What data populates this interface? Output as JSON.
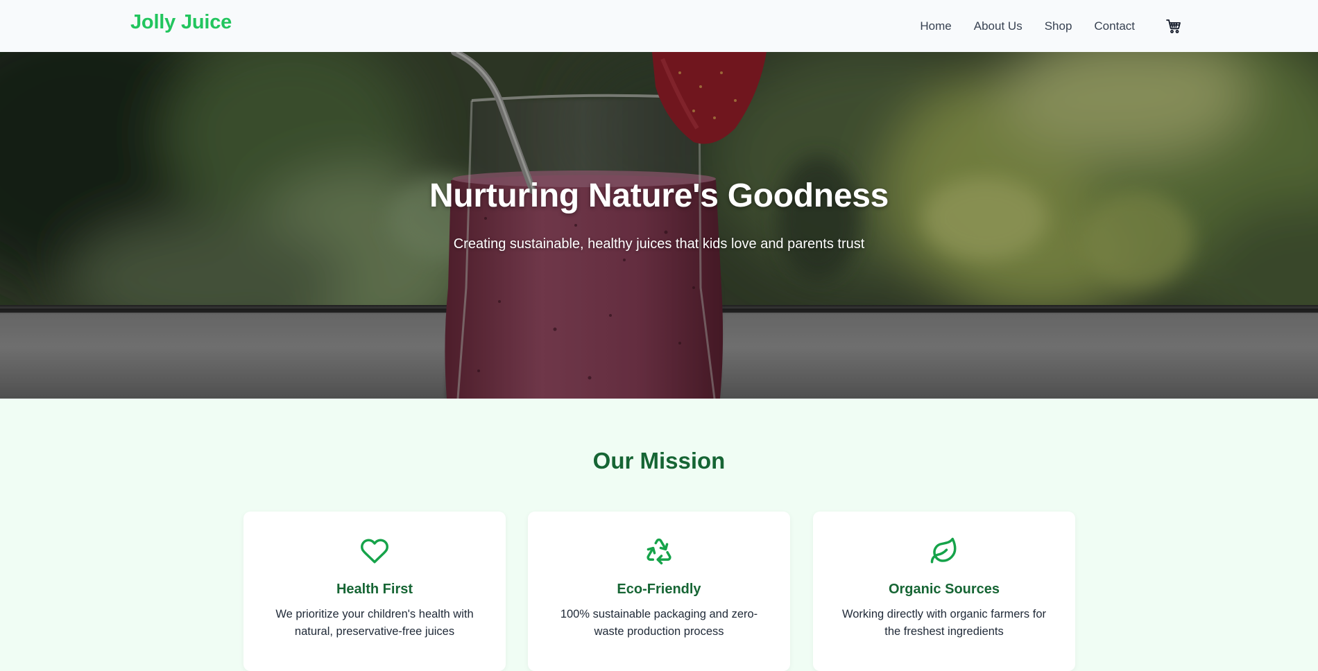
{
  "header": {
    "brand": "Jolly Juice",
    "nav": [
      {
        "label": "Home"
      },
      {
        "label": "About Us"
      },
      {
        "label": "Shop"
      },
      {
        "label": "Contact"
      }
    ],
    "cart_icon": "shopping-cart-icon",
    "brand_color": "#22c55e"
  },
  "hero": {
    "title": "Nurturing Nature's Goodness",
    "subtitle": "Creating sustainable, healthy juices that kids love and parents trust"
  },
  "mission": {
    "title": "Our Mission",
    "title_color": "#166534",
    "cards": [
      {
        "icon": "heart-icon",
        "title": "Health First",
        "text": "We prioritize your children's health with natural, preservative-free juices"
      },
      {
        "icon": "recycle-icon",
        "title": "Eco-Friendly",
        "text": "100% sustainable packaging and zero-waste production process"
      },
      {
        "icon": "leaf-icon",
        "title": "Organic Sources",
        "text": "Working directly with organic farmers for the freshest ingredients"
      }
    ],
    "icon_color": "#16a34a"
  }
}
